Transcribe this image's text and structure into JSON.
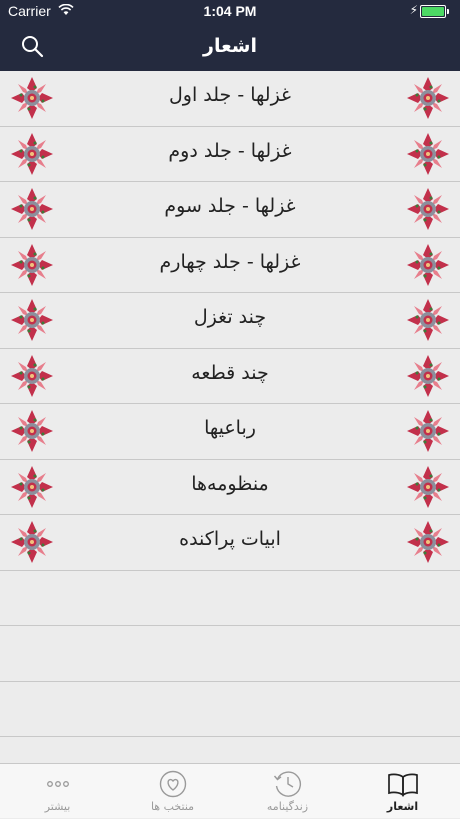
{
  "status_bar": {
    "carrier": "Carrier",
    "time": "1:04 PM"
  },
  "nav": {
    "title": "اشعار",
    "search_icon": "search-icon"
  },
  "list": {
    "items": [
      {
        "label": "غزلها - جلد اول"
      },
      {
        "label": "غزلها - جلد دوم"
      },
      {
        "label": "غزلها - جلد سوم"
      },
      {
        "label": "غزلها - جلد چهارم"
      },
      {
        "label": "چند تغزل"
      },
      {
        "label": "چند قطعه"
      },
      {
        "label": "رباعیها"
      },
      {
        "label": "منظومه‌ها"
      },
      {
        "label": "ابیات پراکنده"
      }
    ],
    "ornament_icon": "floral-ornament-icon"
  },
  "tabbar": {
    "tabs": [
      {
        "label": "بیشتر",
        "icon": "more-dots-icon"
      },
      {
        "label": "منتخب ها",
        "icon": "heart-icon"
      },
      {
        "label": "زندگینامه",
        "icon": "clock-history-icon"
      },
      {
        "label": "اشعار",
        "icon": "open-book-icon",
        "active": true
      }
    ]
  },
  "colors": {
    "header_bg": "#242a3e",
    "list_bg": "#ececec",
    "ornament": "#c2304b",
    "battery": "#4cd964"
  }
}
